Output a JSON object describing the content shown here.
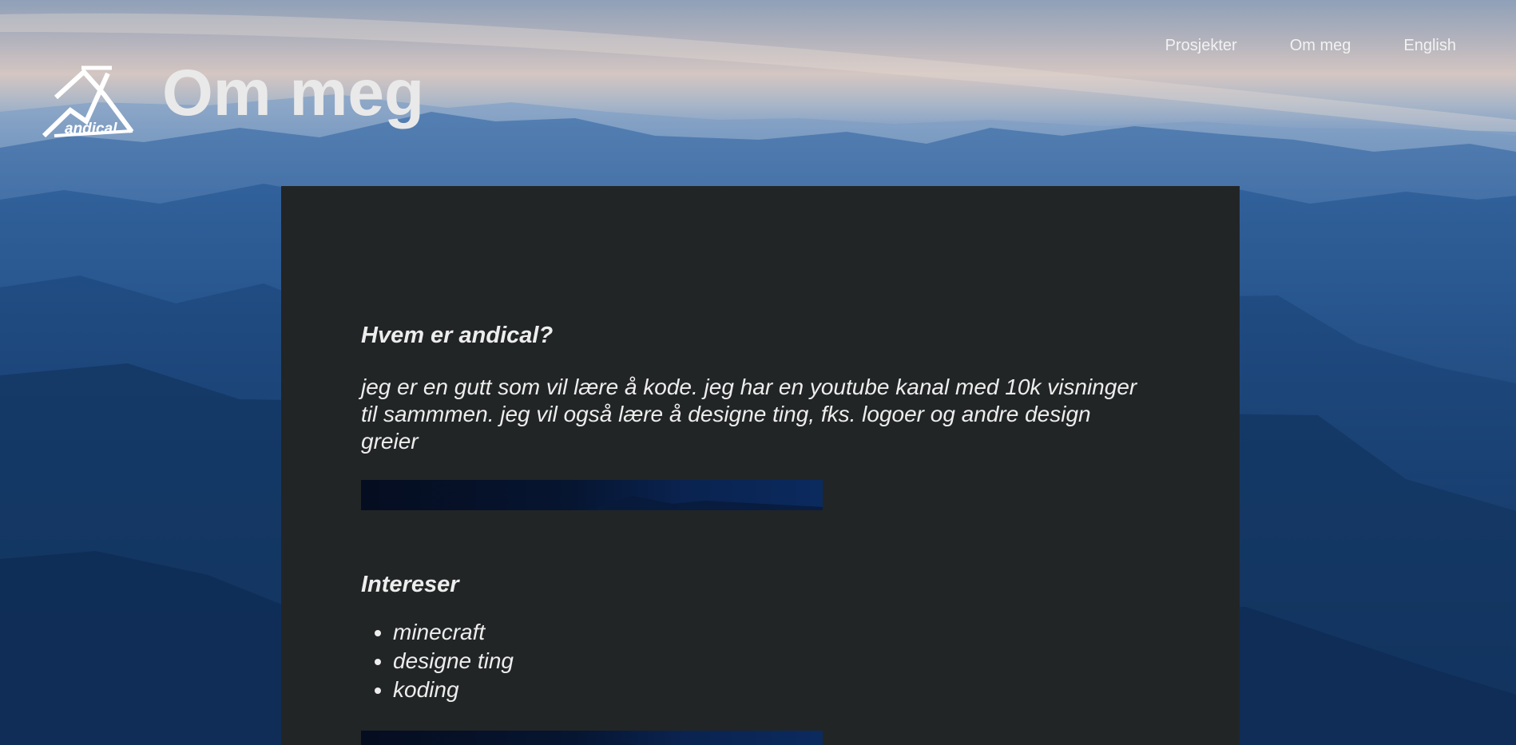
{
  "header": {
    "logo_text": "andical",
    "title": "Om meg"
  },
  "nav": {
    "items": [
      {
        "label": "Prosjekter"
      },
      {
        "label": "Om meg"
      },
      {
        "label": "English"
      }
    ]
  },
  "about": {
    "heading": "Hvem er andical?",
    "text": "jeg er en gutt som vil lære å kode. jeg har en youtube kanal med 10k visninger til sammmen. jeg vil også lære å designe ting, fks. logoer og andre design greier"
  },
  "interests": {
    "heading": "Intereser",
    "items": [
      "minecraft",
      "designe ting",
      "koding"
    ]
  },
  "colors": {
    "panel": "#222526",
    "text": "#ededed",
    "sky": "#d4c6c2",
    "mountain": "#24528a"
  }
}
